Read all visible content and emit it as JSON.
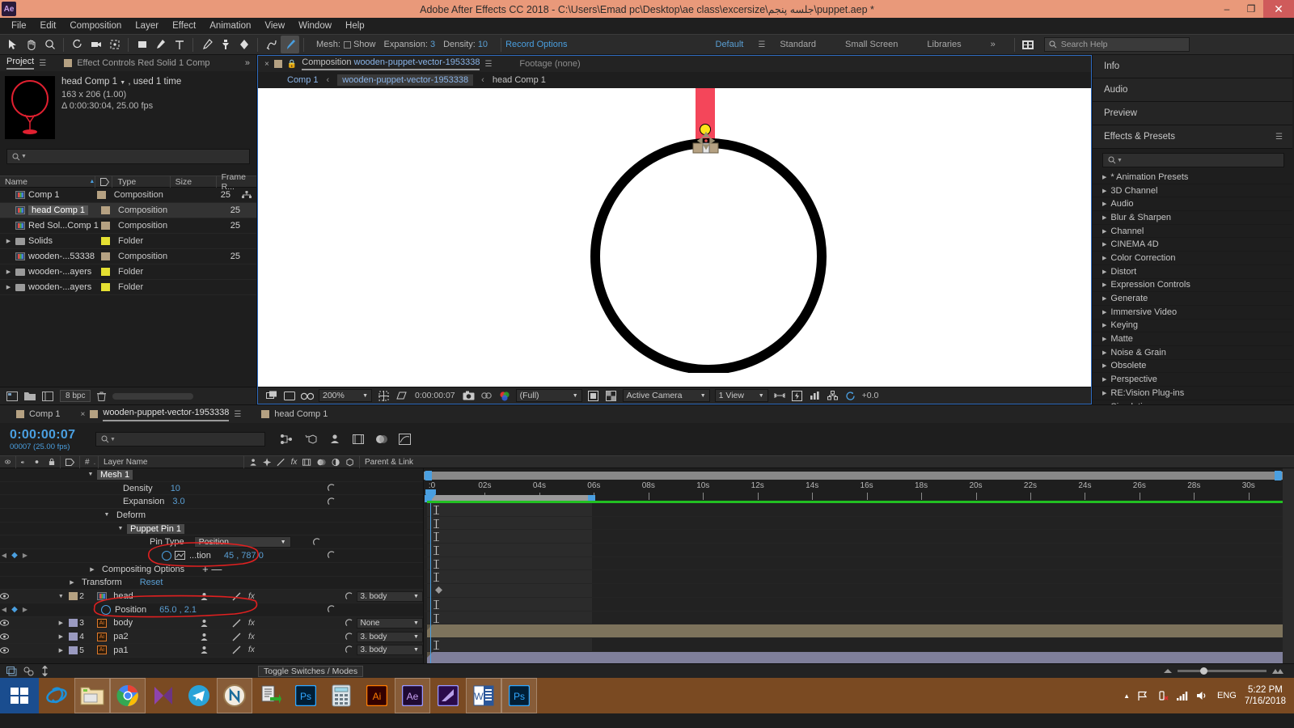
{
  "titlebar": {
    "app_badge": "Ae",
    "title": "Adobe After Effects CC 2018 - C:\\Users\\Emad pc\\Desktop\\ae class\\excersize\\جلسه پنجم\\puppet.aep *",
    "minimize": "–",
    "restore": "❐",
    "close": "✕"
  },
  "menu": [
    "File",
    "Edit",
    "Composition",
    "Layer",
    "Effect",
    "Animation",
    "View",
    "Window",
    "Help"
  ],
  "toolbar": {
    "mesh_label": "Mesh:",
    "show_label": "Show",
    "expansion_label": "Expansion:",
    "expansion_value": "3",
    "density_label": "Density:",
    "density_value": "10",
    "record_options": "Record Options",
    "workspaces": [
      "Default",
      "Standard",
      "Small Screen",
      "Libraries"
    ],
    "selected_workspace": "Default",
    "overflow": "»",
    "search_help_placeholder": "Search Help"
  },
  "project": {
    "tab_active": "Project",
    "tab_other": "Effect Controls  Red Solid 1 Comp",
    "overflow": "»",
    "item_title": "head Comp 1",
    "item_used": ", used 1 time",
    "item_dims": "163 x 206 (1.00)",
    "item_duration": "Δ 0:00:30:04, 25.00 fps",
    "search_placeholder": "",
    "columns": [
      "Name",
      "Type",
      "Size",
      "Frame R..."
    ],
    "rows": [
      {
        "name": "Comp 1",
        "kind": "comp",
        "type": "Composition",
        "size": "",
        "fr": "25",
        "selected": false,
        "disclosure": false
      },
      {
        "name": "head Comp 1",
        "kind": "comp",
        "type": "Composition",
        "size": "",
        "fr": "25",
        "selected": true,
        "disclosure": false
      },
      {
        "name": "Red Sol...Comp 1",
        "kind": "comp",
        "type": "Composition",
        "size": "",
        "fr": "25",
        "selected": false,
        "disclosure": false
      },
      {
        "name": "Solids",
        "kind": "folder",
        "type": "Folder",
        "size": "",
        "fr": "",
        "selected": false,
        "disclosure": true
      },
      {
        "name": "wooden-...53338",
        "kind": "comp",
        "type": "Composition",
        "size": "",
        "fr": "25",
        "selected": false,
        "disclosure": false
      },
      {
        "name": "wooden-...ayers",
        "kind": "folder",
        "type": "Folder",
        "size": "",
        "fr": "",
        "selected": false,
        "disclosure": true
      },
      {
        "name": "wooden-...ayers",
        "kind": "folder",
        "type": "Folder",
        "size": "",
        "fr": "",
        "selected": false,
        "disclosure": true
      }
    ],
    "bit_depth": "8 bpc"
  },
  "viewer": {
    "tab_close": "×",
    "tab_prefix": "Composition",
    "tab_name": "wooden-puppet-vector-1953338",
    "tab_footage": "Footage (none)",
    "breadcrumb": [
      "Comp 1",
      "wooden-puppet-vector-1953338",
      "head Comp 1"
    ],
    "breadcrumb_active": "wooden-puppet-vector-1953338",
    "zoom": "200%",
    "time": "0:00:00:07",
    "resolution": "(Full)",
    "camera": "Active Camera",
    "views": "1 View",
    "exposure": "+0.0"
  },
  "right_panels": {
    "sections": [
      "Info",
      "Audio",
      "Preview"
    ],
    "effects_title": "Effects & Presets",
    "effects_search_placeholder": "",
    "effects": [
      "* Animation Presets",
      "3D Channel",
      "Audio",
      "Blur & Sharpen",
      "Channel",
      "CINEMA 4D",
      "Color Correction",
      "Distort",
      "Expression Controls",
      "Generate",
      "Immersive Video",
      "Keying",
      "Matte",
      "Noise & Grain",
      "Obsolete",
      "Perspective",
      "RE:Vision Plug-ins",
      "Simulation"
    ]
  },
  "timeline": {
    "tabs": [
      {
        "label": "Comp 1",
        "active": false,
        "closable": false
      },
      {
        "label": "wooden-puppet-vector-1953338",
        "active": true,
        "closable": true
      },
      {
        "label": "head Comp 1",
        "active": false,
        "closable": false
      }
    ],
    "current_time": "0:00:00:07",
    "frame_info": "00007 (25.00 fps)",
    "search_placeholder": "",
    "columns": [
      "#",
      "Layer Name",
      "Parent & Link"
    ],
    "rows": [
      {
        "kind": "group",
        "indent": 118,
        "tri": "▼",
        "name": "Mesh 1",
        "value": "",
        "highlight": true
      },
      {
        "kind": "prop",
        "indent": 152,
        "name": "Density",
        "value": "10",
        "stopwatch": false
      },
      {
        "kind": "prop",
        "indent": 152,
        "name": "Expansion",
        "value": "3.0",
        "stopwatch": false
      },
      {
        "kind": "group",
        "indent": 138,
        "tri": "▼",
        "name": "Deform",
        "value": "",
        "highlight": false
      },
      {
        "kind": "group",
        "indent": 155,
        "tri": "▼",
        "name": "Puppet Pin 1",
        "value": "",
        "highlight": true
      },
      {
        "kind": "select",
        "indent": 185,
        "name": "Pin Type",
        "value": "Position"
      },
      {
        "kind": "keyed",
        "indent": 200,
        "name": "...tion",
        "value": "45 , 787.0",
        "annotated": true
      },
      {
        "kind": "group",
        "indent": 120,
        "tri": "▶",
        "name": "Compositing Options",
        "value": "+ —",
        "highlight": false
      },
      {
        "kind": "group",
        "indent": 95,
        "tri": "▶",
        "name": "Transform",
        "value": "Reset",
        "highlight": false
      },
      {
        "kind": "layer",
        "num": "2",
        "name": "head",
        "icon": "comp",
        "parent": "3. body",
        "tri": "▼",
        "swatch": "#b5a182",
        "selected": true
      },
      {
        "kind": "keyed",
        "indent": 125,
        "name": "Position",
        "value": "65.0 , 2.1",
        "annotated": true
      },
      {
        "kind": "layer",
        "num": "3",
        "name": "body",
        "icon": "ai",
        "parent": "None",
        "tri": "▶",
        "swatch": "#9a9ac0",
        "selected": false
      },
      {
        "kind": "layer",
        "num": "4",
        "name": "pa2",
        "icon": "ai",
        "parent": "3. body",
        "tri": "▶",
        "swatch": "#9a9ac0",
        "selected": false
      },
      {
        "kind": "layer",
        "num": "5",
        "name": "pa1",
        "icon": "ai",
        "parent": "3. body",
        "tri": "▶",
        "swatch": "#9a9ac0",
        "selected": false
      }
    ],
    "ruler_ticks": [
      "02s",
      "04s",
      "06s",
      "08s",
      "10s",
      "12s",
      "14s",
      "16s",
      "18s",
      "20s",
      "22s",
      "24s",
      "26s",
      "28s",
      "30s"
    ],
    "ruler_start": ":0",
    "toggle_switches_modes": "Toggle Switches / Modes"
  },
  "taskbar": {
    "start": "start",
    "items": [
      {
        "name": "internet-explorer",
        "label": "e"
      },
      {
        "name": "file-explorer",
        "label": ""
      },
      {
        "name": "google-chrome",
        "label": ""
      },
      {
        "name": "media-player",
        "label": ""
      },
      {
        "name": "telegram",
        "label": ""
      },
      {
        "name": "nero",
        "label": "N"
      },
      {
        "name": "document-app",
        "label": ""
      },
      {
        "name": "photoshop",
        "label": "Ps"
      },
      {
        "name": "calculator",
        "label": ""
      },
      {
        "name": "illustrator",
        "label": "Ai"
      },
      {
        "name": "after-effects",
        "label": "Ae"
      },
      {
        "name": "premiere",
        "label": ""
      },
      {
        "name": "word",
        "label": "W"
      },
      {
        "name": "photoshop-2",
        "label": "Ps"
      }
    ],
    "tray": {
      "language": "ENG",
      "time": "5:22 PM",
      "date": "7/16/2018"
    }
  },
  "colors": {
    "accent_blue": "#4a9fe0",
    "title_bar": "#e9997a",
    "taskbar": "#7a4a22",
    "annotation_red": "#e02020",
    "work_area_green": "#22c022"
  }
}
